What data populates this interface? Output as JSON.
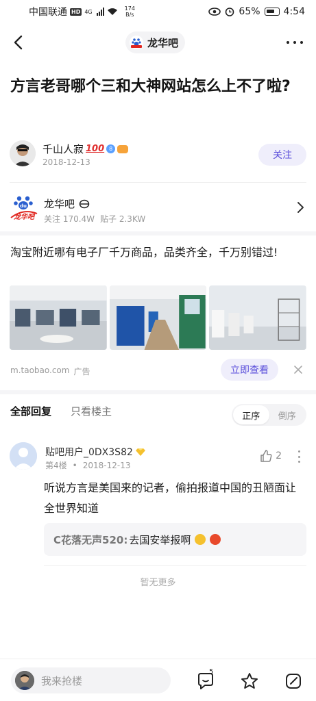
{
  "status_bar": {
    "carrier": "中国联通",
    "hd": "HD",
    "network": "4G",
    "speed_value": "174",
    "speed_unit": "B/s",
    "battery": "65%",
    "time": "4:54"
  },
  "nav": {
    "forum_name": "龙华吧",
    "mini_logo_text": "龙华吧"
  },
  "post": {
    "title": "方言老哥哪个三和大神网站怎么上不了啦?"
  },
  "author": {
    "name": "千山人寂",
    "badge_100": "100",
    "level": "8",
    "date": "2018-12-13",
    "follow_label": "关注"
  },
  "forum": {
    "name": "龙华吧",
    "followers": "关注 170.4W",
    "posts": "贴子 2.3KW",
    "logo_text": "龙华吧"
  },
  "ad": {
    "text": "淘宝附近哪有电子厂千万商品，品类齐全，千万别错过!",
    "source": "m.taobao.com",
    "tag": "广告",
    "cta": "立即查看"
  },
  "tabs": {
    "all": "全部回复",
    "owner_only": "只看楼主",
    "sort_asc": "正序",
    "sort_desc": "倒序"
  },
  "reply": {
    "user": "贴吧用户_0DX3S82",
    "floor": "第4楼",
    "dot": "•",
    "date": "2018-12-13",
    "likes": "2",
    "body": "听说方言是美国来的记者，偷拍报道中国的丑陋面让全世界知道",
    "sub_name": "C花落无声520:",
    "sub_text": "去国安举报啊"
  },
  "no_more": "暂无更多",
  "bottom": {
    "placeholder": "我来抢楼",
    "comment_count": "5"
  },
  "icons": [
    "back-icon",
    "more-icon",
    "chevron-right-icon",
    "close-icon",
    "thumb-up-icon",
    "comment-icon",
    "star-icon",
    "edit-icon",
    "wifi-icon",
    "eye-icon",
    "alarm-icon"
  ],
  "colors": {
    "accent": "#5b4fdb",
    "accent_bg": "#efeefb",
    "muted": "#999999",
    "band": "#f5f5f7"
  }
}
